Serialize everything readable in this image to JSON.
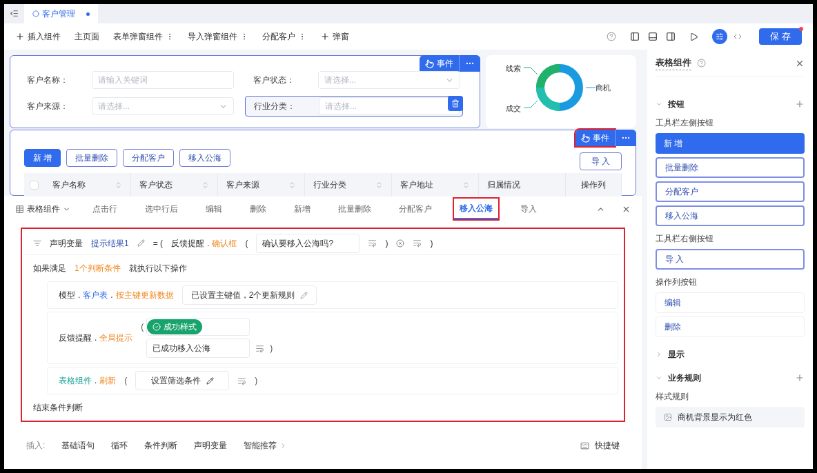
{
  "tab_bar": {
    "tabs": [
      {
        "label": "客户管理",
        "selected": true,
        "modified": true
      }
    ]
  },
  "toolbar": {
    "insert": "插入组件",
    "pages": [
      {
        "label": "主页面",
        "has_menu": false
      },
      {
        "label": "表单弹窗组件",
        "has_menu": true
      },
      {
        "label": "导入弹窗组件",
        "has_menu": true
      },
      {
        "label": "分配客户",
        "has_menu": true
      }
    ],
    "add_popup": "弹窗",
    "view_toggle": [
      {
        "kind": "settings",
        "selected": true
      },
      {
        "kind": "code",
        "selected": false
      }
    ],
    "save": "保 存",
    "save_unsaved": true
  },
  "filter_form": {
    "event_button": "事件",
    "fields": [
      {
        "label": "客户名称：",
        "placeholder": "请输入关键词",
        "kind": "text",
        "selected": false
      },
      {
        "label": "客户状态：",
        "placeholder": "请选择...",
        "kind": "select",
        "selected": false
      },
      {
        "label": "客户来源：",
        "placeholder": "请选择...",
        "kind": "select",
        "selected": false
      },
      {
        "label": "行业分类：",
        "placeholder": "请选择...",
        "kind": "select",
        "selected": true
      }
    ]
  },
  "chart": {
    "labels": [
      "线索",
      "商机",
      "成交"
    ]
  },
  "table": {
    "event_button": "事件",
    "event_highlighted": true,
    "left_buttons": [
      {
        "label": "新 增",
        "primary": true
      },
      {
        "label": "批量删除",
        "primary": false
      },
      {
        "label": "分配客户",
        "primary": false
      },
      {
        "label": "移入公海",
        "primary": false
      }
    ],
    "right_buttons": [
      "导 入"
    ],
    "select_all": {
      "checked": false
    },
    "columns": [
      {
        "label": "客户名称",
        "sortable": true
      },
      {
        "label": "客户状态",
        "sortable": true
      },
      {
        "label": "客户来源",
        "sortable": true
      },
      {
        "label": "行业分类",
        "sortable": true
      },
      {
        "label": "客户地址",
        "sortable": true
      },
      {
        "label": "归属情况",
        "sortable": false
      },
      {
        "label": "操作列",
        "sortable": false
      }
    ]
  },
  "event_panel": {
    "component": "表格组件",
    "tabs": [
      {
        "label": "点击行",
        "selected": false,
        "highlighted": false
      },
      {
        "label": "选中行后",
        "selected": false,
        "highlighted": false
      },
      {
        "label": "编辑",
        "selected": false,
        "highlighted": false
      },
      {
        "label": "删除",
        "selected": false,
        "highlighted": false
      },
      {
        "label": "新增",
        "selected": false,
        "highlighted": false
      },
      {
        "label": "批量删除",
        "selected": false,
        "highlighted": false
      },
      {
        "label": "分配客户",
        "selected": false,
        "highlighted": false
      },
      {
        "label": "移入公海",
        "selected": true,
        "highlighted": true
      },
      {
        "label": "导入",
        "selected": false,
        "highlighted": false
      }
    ],
    "declare": {
      "keyword": "声明变量",
      "variable": "提示结果1",
      "equals": "= (",
      "target": "反馈提醒",
      "separator": ".",
      "method": "确认框",
      "paren_open": "(",
      "value": "确认要移入公海吗?",
      "paren_close": ")",
      "close": ")"
    },
    "condition": {
      "prefix": "如果满足",
      "count": "1个判断条件",
      "suffix": "就执行以下操作"
    },
    "steps": [
      {
        "kind": "update",
        "parts": [
          "模型",
          "客户表",
          "按主键更新数据"
        ],
        "separator": ".",
        "value": "已设置主键值，2个更新规则"
      },
      {
        "kind": "message",
        "parts": [
          "反馈提醒",
          "全局提示"
        ],
        "separator": ".",
        "paren_open": "(",
        "style": "成功样式",
        "value": "已成功移入公海",
        "paren_close": ")"
      },
      {
        "kind": "refresh",
        "parts": [
          "表格组件",
          "刷新"
        ],
        "separator": ".",
        "paren_open": "(",
        "value": "设置筛选条件",
        "paren_close": ")"
      }
    ],
    "end": "结束条件判断",
    "insert_label": "插入:",
    "insert_options": [
      "基础语句",
      "循环",
      "条件判断",
      "声明变量"
    ],
    "more_option": "智能推荐",
    "shortcut": "快捷键"
  },
  "props_panel": {
    "title": "表格组件",
    "sections": [
      {
        "title": "按钮",
        "expanded": true,
        "addable": true,
        "groups": [
          {
            "title": "工具栏左侧按钮",
            "items": [
              {
                "label": "新 增",
                "selected": true
              },
              {
                "label": "批量删除",
                "selected": false,
                "outlined": true
              },
              {
                "label": "分配客户",
                "selected": false,
                "outlined": true
              },
              {
                "label": "移入公海",
                "selected": false,
                "outlined": true
              }
            ]
          },
          {
            "title": "工具栏右侧按钮",
            "items": [
              {
                "label": "导 入",
                "selected": false,
                "outlined": true
              }
            ]
          },
          {
            "title": "操作列按钮",
            "items": [
              {
                "label": "编辑",
                "selected": false,
                "outlined": false
              },
              {
                "label": "删除",
                "selected": false,
                "outlined": false
              }
            ]
          }
        ]
      },
      {
        "title": "显示",
        "expanded": false,
        "addable": false
      },
      {
        "title": "业务规则",
        "expanded": true,
        "addable": true,
        "groups": [
          {
            "title": "样式规则",
            "items": [
              {
                "label": "商机背景显示为红色",
                "selected": false,
                "kind": "rule"
              }
            ]
          }
        ]
      }
    ]
  }
}
